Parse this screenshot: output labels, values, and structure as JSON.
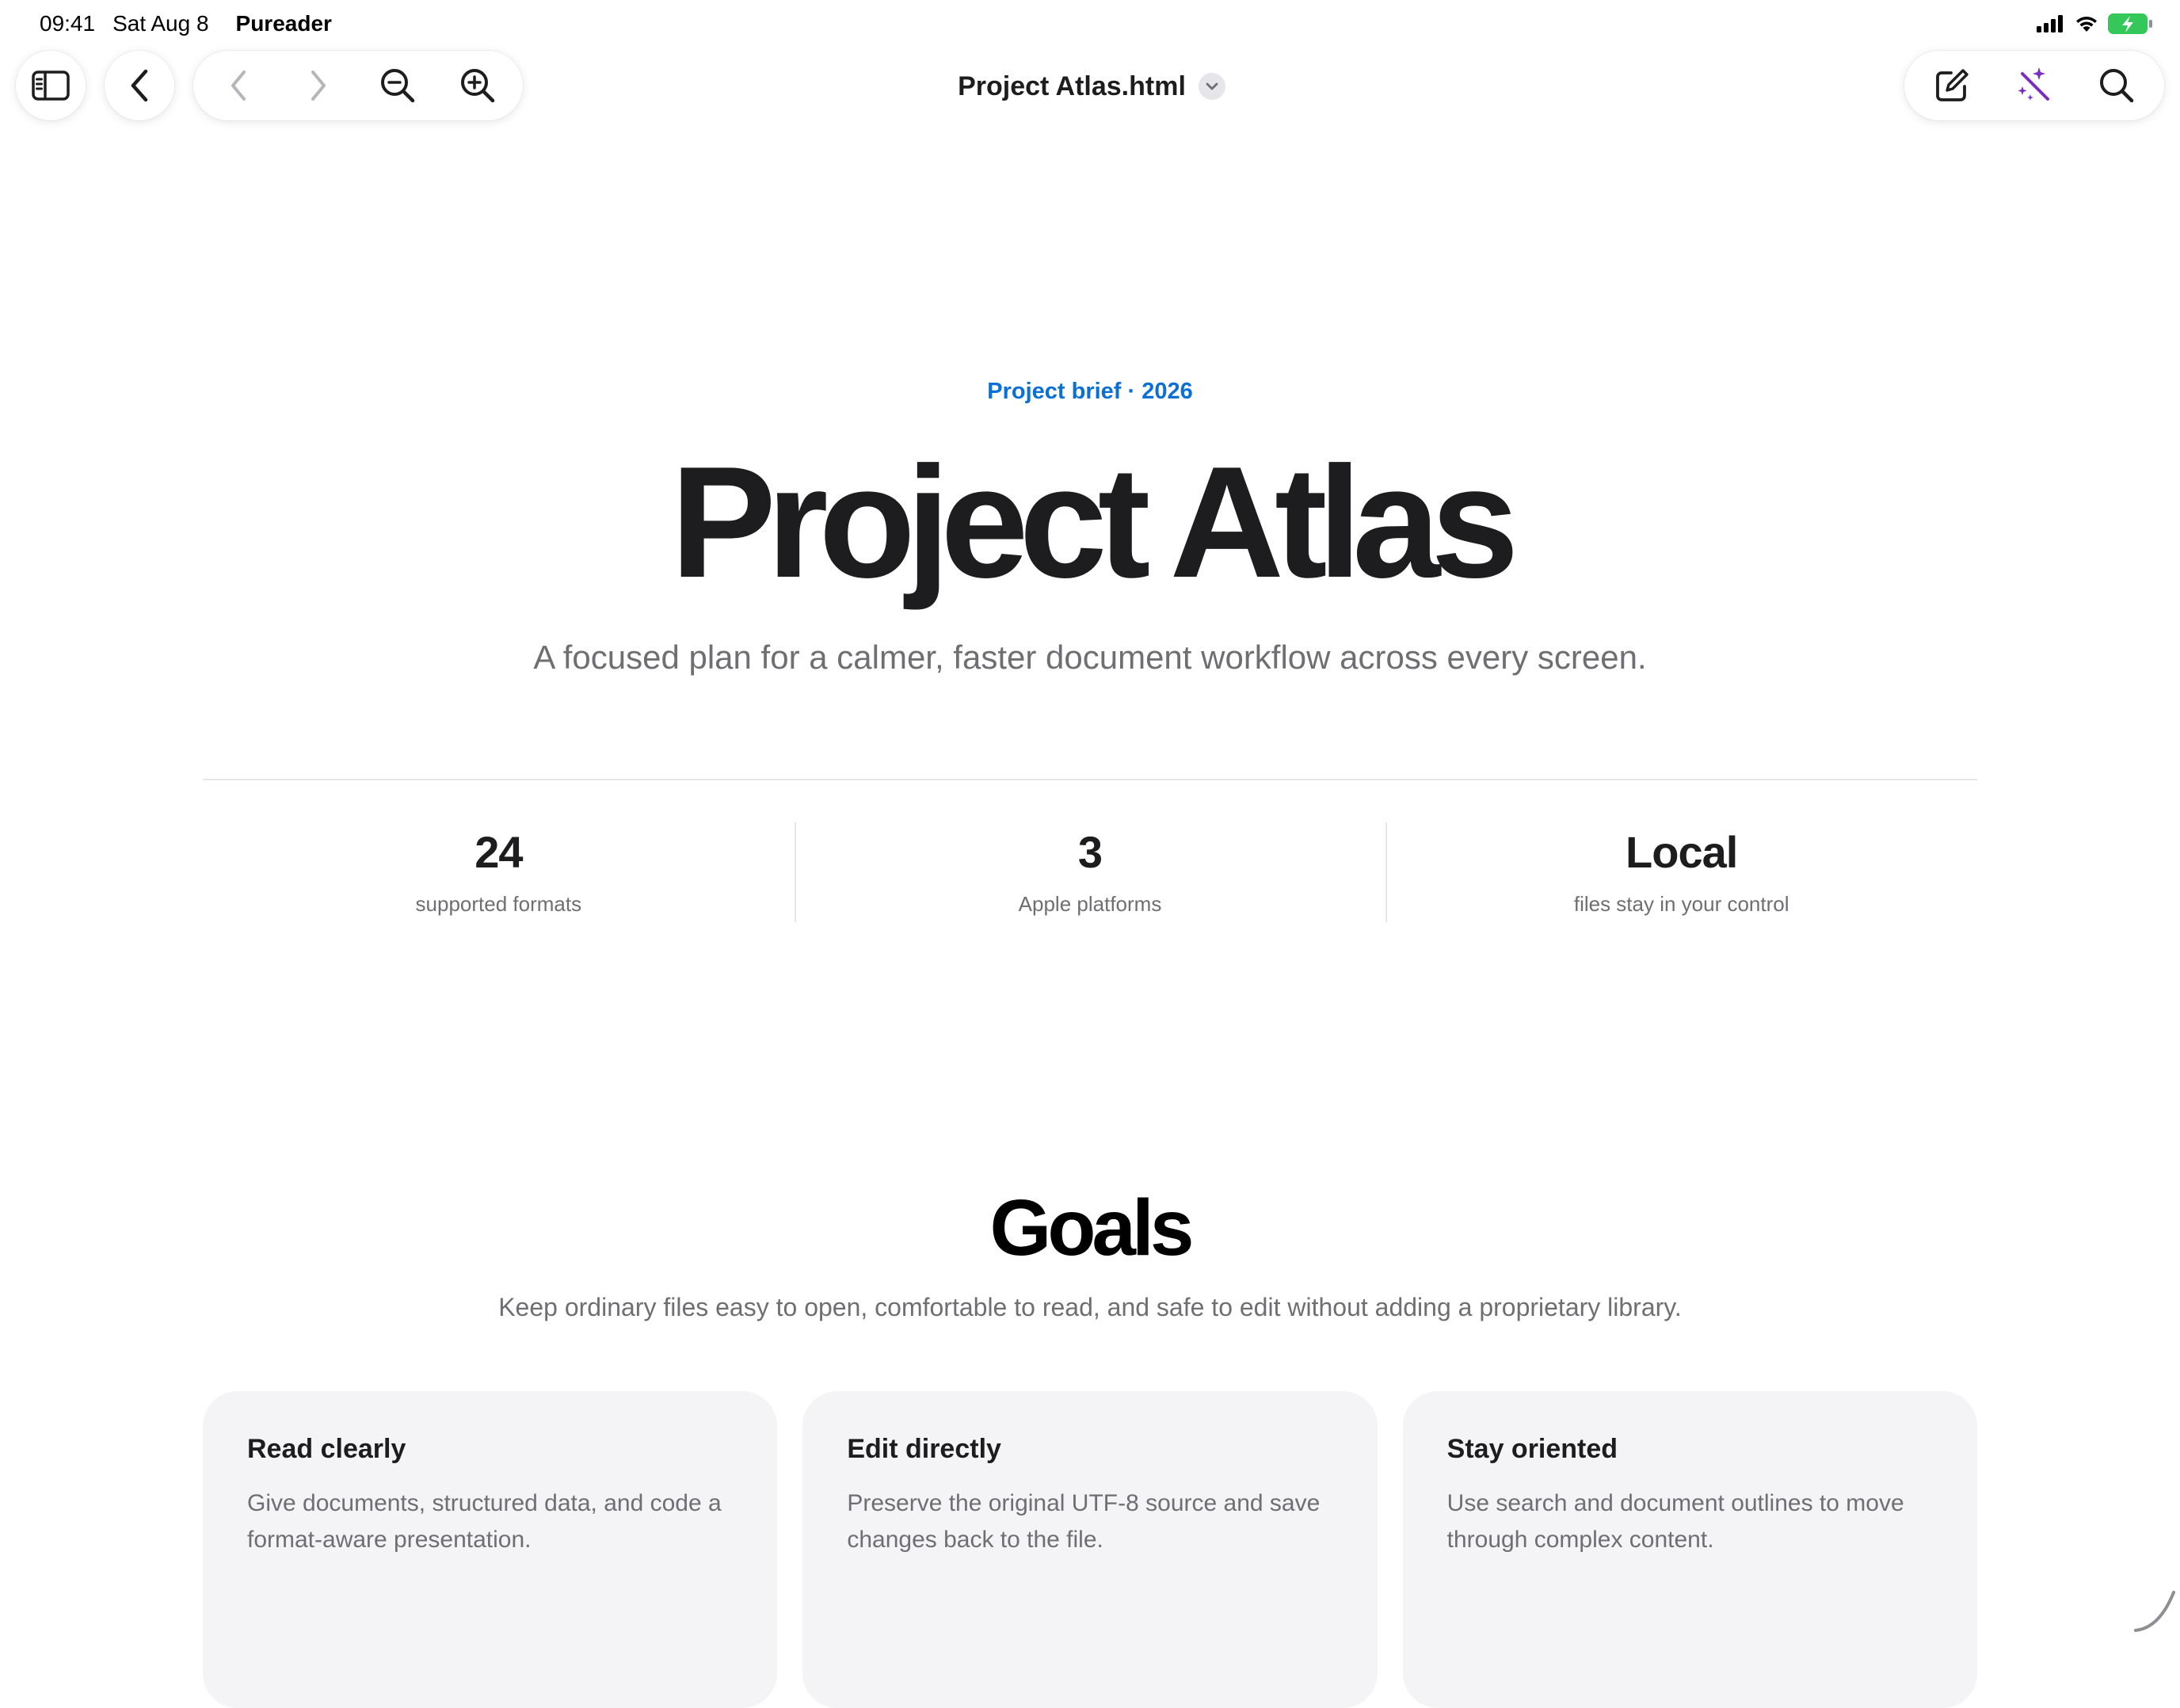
{
  "status_bar": {
    "time": "09:41",
    "date": "Sat Aug 8",
    "app": "Pureader",
    "icons": [
      "cellular-signal-icon",
      "wifi-icon",
      "battery-charging-icon"
    ],
    "battery_color": "#34c759"
  },
  "toolbar": {
    "left_icons": [
      "sidebar-icon",
      "back-icon"
    ],
    "nav_icons": [
      "previous-icon",
      "next-icon",
      "zoom-out-icon",
      "zoom-in-icon"
    ],
    "document_title": "Project Atlas.html",
    "right_icons": [
      "compose-icon",
      "magic-wand-icon",
      "search-icon"
    ],
    "magic_color": "#7b2fbe"
  },
  "document": {
    "eyebrow": "Project brief · 2026",
    "title": "Project Atlas",
    "subtitle": "A focused plan for a calmer, faster document workflow across every screen.",
    "accent_color": "#0a6fd6",
    "stats": [
      {
        "value": "24",
        "label": "supported formats"
      },
      {
        "value": "3",
        "label": "Apple platforms"
      },
      {
        "value": "Local",
        "label": "files stay in your control"
      }
    ],
    "goals": {
      "title": "Goals",
      "subtitle": "Keep ordinary files easy to open, comfortable to read, and safe to edit without adding a proprietary library.",
      "cards": [
        {
          "title": "Read clearly",
          "text": "Give documents, structured data, and code a format-aware presentation."
        },
        {
          "title": "Edit directly",
          "text": "Preserve the original UTF-8 source and save changes back to the file."
        },
        {
          "title": "Stay oriented",
          "text": "Use search and document outlines to move through complex content."
        }
      ]
    }
  }
}
